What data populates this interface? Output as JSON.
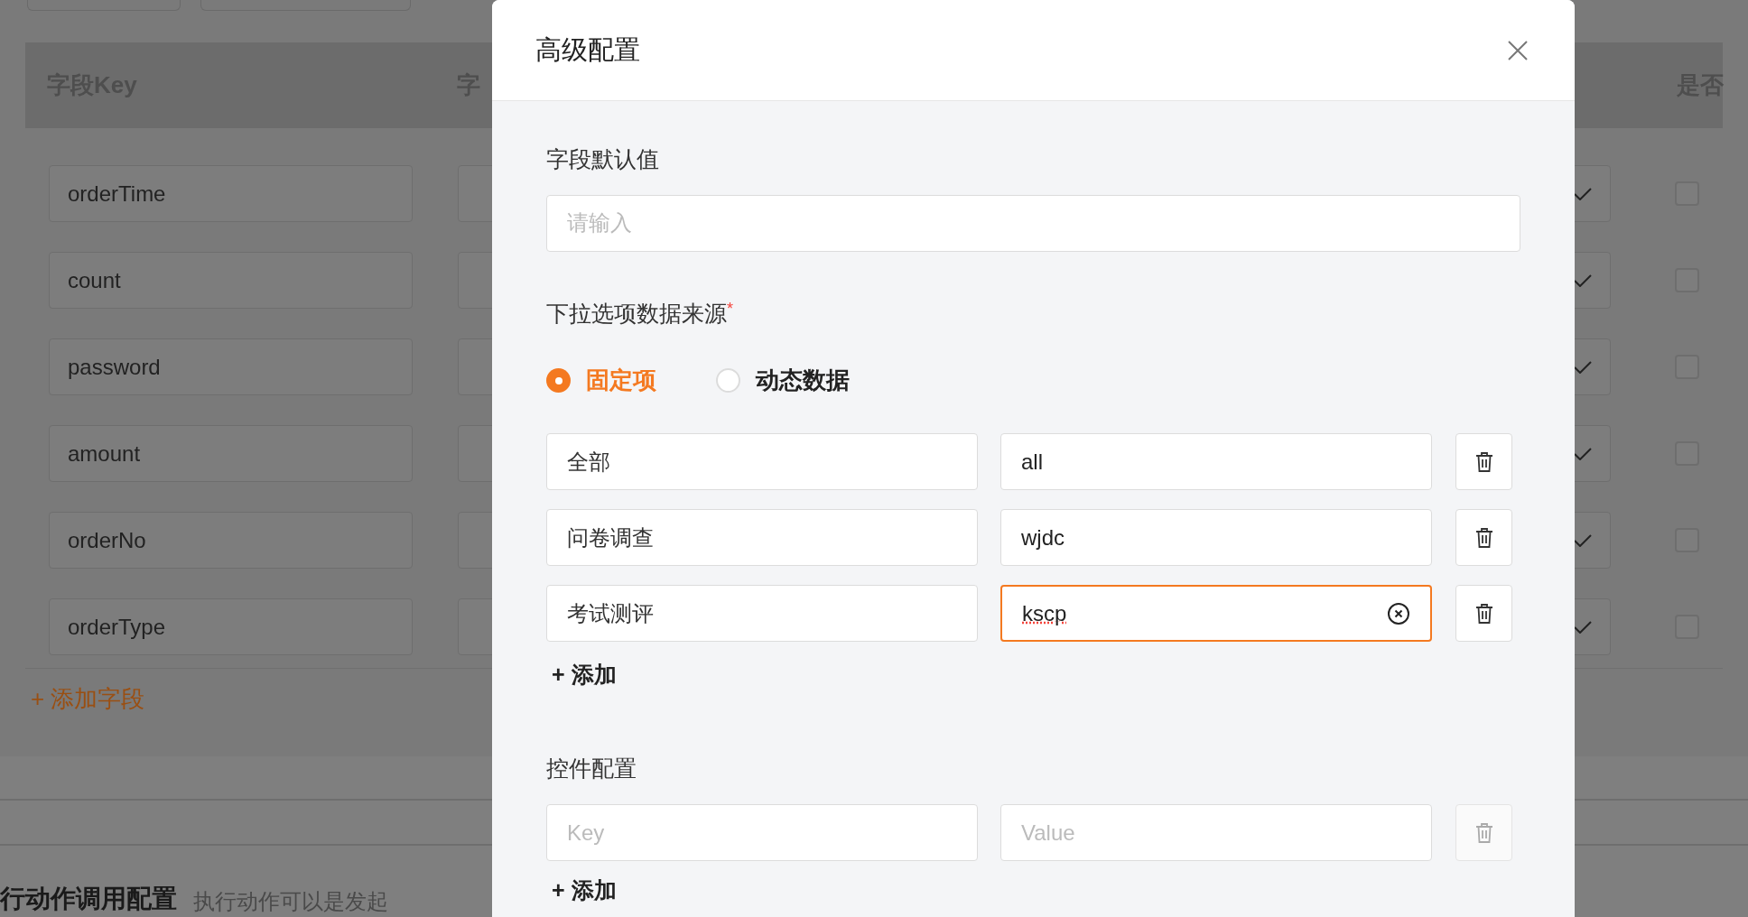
{
  "background": {
    "header": {
      "column_1": "字段Key",
      "column_2": "字",
      "column_5": "是否"
    },
    "rows": [
      {
        "key": "orderTime",
        "required": false
      },
      {
        "key": "count",
        "required": false
      },
      {
        "key": "password",
        "required": false
      },
      {
        "key": "amount",
        "required": false
      },
      {
        "key": "orderNo",
        "required": false
      },
      {
        "key": "orderType",
        "required": false
      }
    ],
    "add_field": "+ 添加字段",
    "section_title": "行动作调用配置",
    "section_hint": "执行动作可以是发起"
  },
  "dialog": {
    "title": "高级配置",
    "default_value": {
      "label": "字段默认值",
      "placeholder": "请输入"
    },
    "source": {
      "label": "下拉选项数据来源",
      "required_mark": "*",
      "options": [
        {
          "label": "固定项",
          "selected": true
        },
        {
          "label": "动态数据",
          "selected": false
        }
      ]
    },
    "options": [
      {
        "label": "全部",
        "value": "all",
        "focused": false
      },
      {
        "label": "问卷调查",
        "value": "wjdc",
        "focused": false
      },
      {
        "label": "考试测评",
        "value": "kscp",
        "focused": true
      }
    ],
    "add_option": "+ 添加",
    "control_config": {
      "label": "控件配置",
      "rows": [
        {
          "key_placeholder": "Key",
          "value_placeholder": "Value",
          "disabled": true
        }
      ],
      "add": "+ 添加"
    }
  }
}
